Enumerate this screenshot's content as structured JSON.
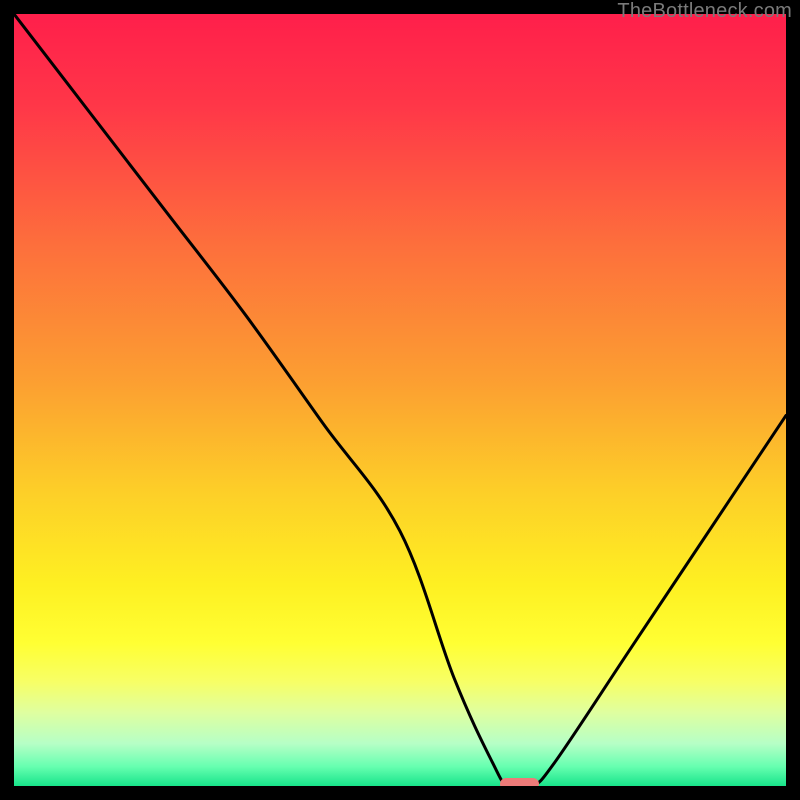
{
  "watermark": "TheBottleneck.com",
  "chart_data": {
    "type": "line",
    "title": "",
    "xlabel": "",
    "ylabel": "",
    "xlim": [
      0,
      100
    ],
    "ylim": [
      0,
      100
    ],
    "x": [
      0,
      10,
      20,
      30,
      40,
      50,
      57,
      62,
      64,
      67,
      70,
      80,
      90,
      100
    ],
    "values": [
      100,
      87,
      74,
      61,
      47,
      33,
      14,
      3,
      0,
      0,
      3,
      18,
      33,
      48
    ],
    "minimum_index_range": [
      64,
      67
    ],
    "gradient_stops": [
      {
        "pos": 0.0,
        "color": "#ff1f4b"
      },
      {
        "pos": 0.12,
        "color": "#ff3748"
      },
      {
        "pos": 0.3,
        "color": "#fd6f3c"
      },
      {
        "pos": 0.48,
        "color": "#fca031"
      },
      {
        "pos": 0.62,
        "color": "#fdcf28"
      },
      {
        "pos": 0.74,
        "color": "#fef022"
      },
      {
        "pos": 0.815,
        "color": "#ffff33"
      },
      {
        "pos": 0.865,
        "color": "#f7ff66"
      },
      {
        "pos": 0.905,
        "color": "#dfffa0"
      },
      {
        "pos": 0.945,
        "color": "#b6ffc6"
      },
      {
        "pos": 0.975,
        "color": "#66ffb0"
      },
      {
        "pos": 1.0,
        "color": "#18e48a"
      }
    ],
    "marker": {
      "color": "#ed7b79",
      "x_start": 63,
      "x_end": 68,
      "y": 0
    }
  }
}
